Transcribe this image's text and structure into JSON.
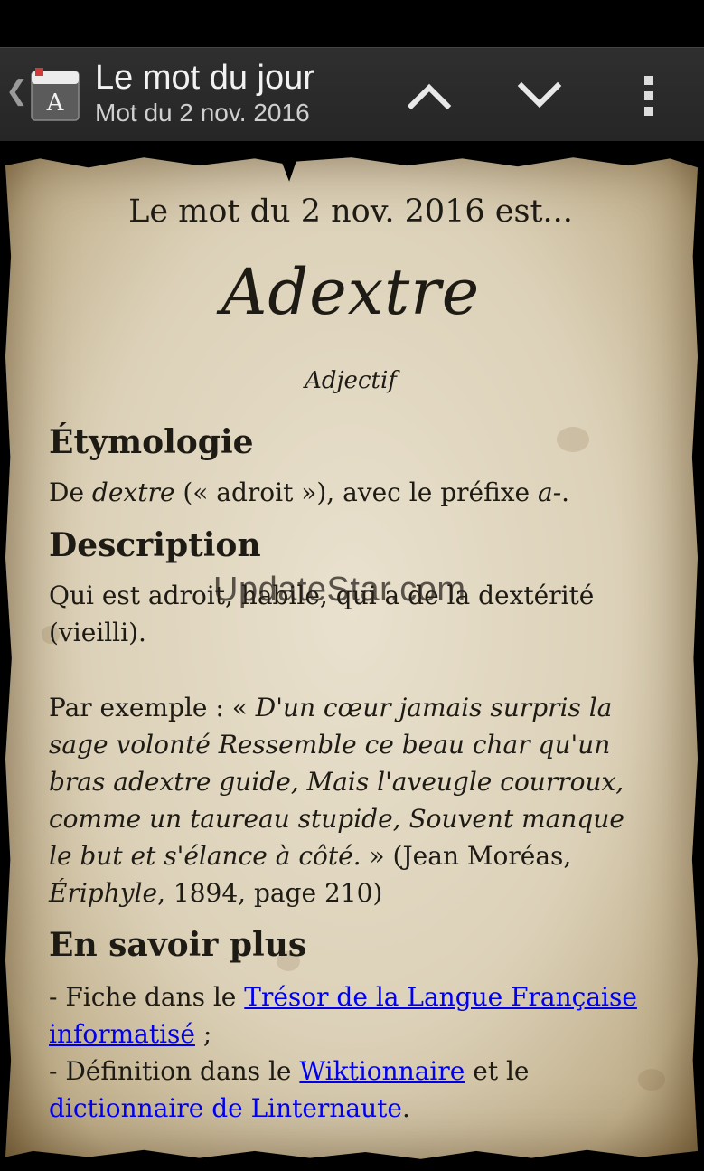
{
  "header": {
    "title": "Le mot du jour",
    "subtitle": "Mot du 2 nov. 2016",
    "app_icon_letter": "A"
  },
  "entry": {
    "date_heading": "Le mot du 2 nov. 2016 est...",
    "word": "Adextre",
    "part_of_speech": "Adjectif",
    "etymology_heading": "Étymologie",
    "etymology": {
      "t1": "De ",
      "t2": "dextre",
      "t3": " (« adroit »), avec le préfixe ",
      "t4": "a-",
      "t5": "."
    },
    "description_heading": "Description",
    "description": "Qui est adroit, habile, qui a de la dextérité (vieilli).",
    "example": {
      "intro": "Par exemple : « ",
      "quote": "D'un cœur jamais surpris la sage volonté Ressemble ce beau char qu'un bras adextre guide, Mais l'aveugle courroux, comme un taureau stupide, Souvent manque le but et s'élance à côté.",
      "after": " » (Jean Moréas, ",
      "work": "Ériphyle",
      "ref": ", 1894, page 210)"
    },
    "more_heading": "En savoir plus",
    "more": {
      "l1_prefix": "- Fiche dans le ",
      "l1_link": "Trésor de la Langue Française informatisé",
      "l1_suffix": " ;",
      "l2_prefix": "- Définition dans le ",
      "l2_link1": "Wiktionnaire",
      "l2_mid": " et le ",
      "l2_link2": "dictionnaire de Linternaute",
      "l2_suffix": "."
    }
  },
  "watermark": "UpdateStar.com",
  "colors": {
    "link": "#0000ee",
    "actionbar": "#2a2a2a",
    "paper": "#e4dac4"
  }
}
